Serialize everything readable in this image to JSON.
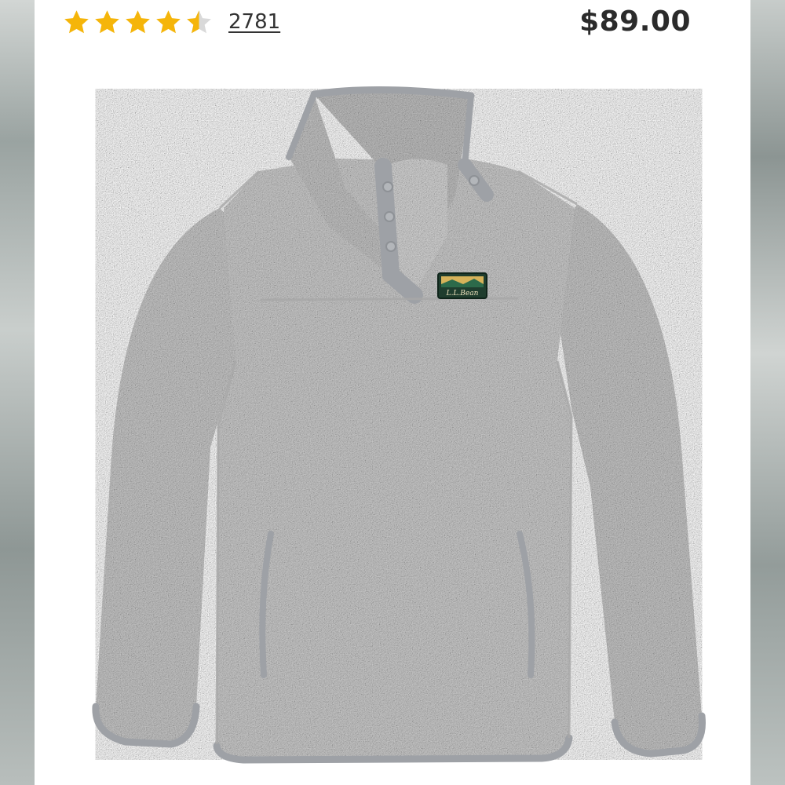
{
  "listing": {
    "rating": 4.5,
    "rating_max": 5,
    "review_count": "2781",
    "price": "$89.00",
    "star_color": "#f5b50a",
    "star_empty_color": "#d9d9d9"
  },
  "product_image": {
    "brand_patch_text": "L.L.Bean",
    "fabric_color": "#c9c9c9",
    "trim_color": "#9ea1a6"
  }
}
